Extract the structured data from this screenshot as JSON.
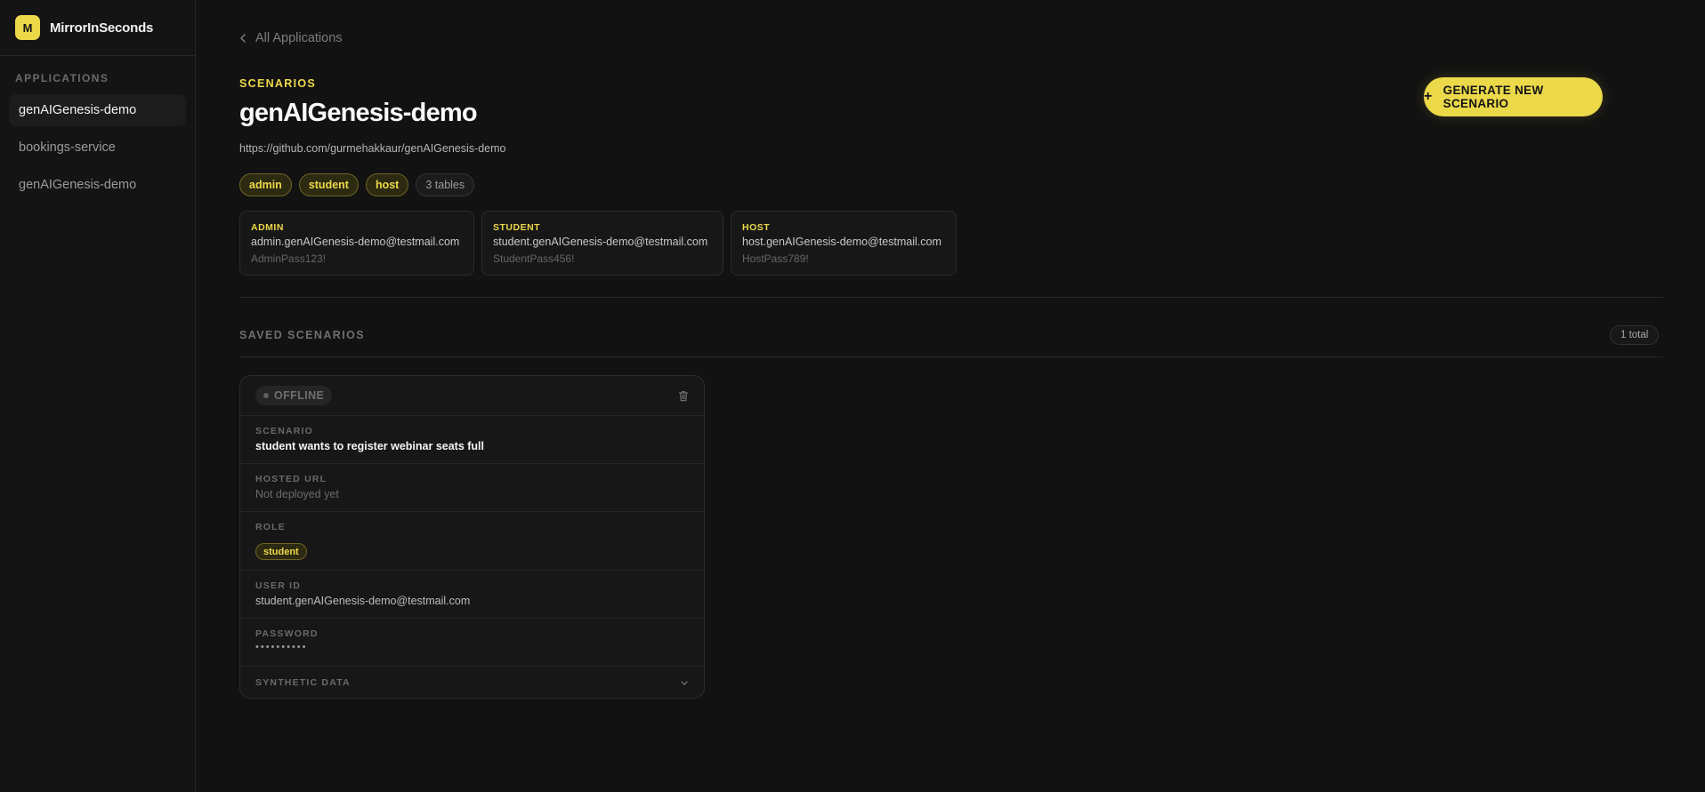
{
  "brand": {
    "logo_letter": "M",
    "name": "MirrorInSeconds"
  },
  "sidebar": {
    "section_label": "APPLICATIONS",
    "items": [
      {
        "label": "genAIGenesis-demo",
        "active": true
      },
      {
        "label": "bookings-service",
        "active": false
      },
      {
        "label": "genAIGenesis-demo",
        "active": false
      }
    ]
  },
  "header": {
    "back_label": "All Applications",
    "eyebrow": "SCENARIOS",
    "title": "genAIGenesis-demo",
    "repo_url": "https://github.com/gurmehakkaur/genAIGenesis-demo",
    "generate_button": {
      "icon": "+",
      "label": "GENERATE NEW SCENARIO"
    }
  },
  "tags": [
    "admin",
    "student",
    "host"
  ],
  "tables_count_label": "3 tables",
  "credentials": [
    {
      "role": "ADMIN",
      "email": "admin.genAIGenesis-demo@testmail.com",
      "password": "AdminPass123!"
    },
    {
      "role": "STUDENT",
      "email": "student.genAIGenesis-demo@testmail.com",
      "password": "StudentPass456!"
    },
    {
      "role": "HOST",
      "email": "host.genAIGenesis-demo@testmail.com",
      "password": "HostPass789!"
    }
  ],
  "saved": {
    "label": "SAVED SCENARIOS",
    "total_label": "1 total"
  },
  "scenario_card": {
    "status": "OFFLINE",
    "scenario_label": "SCENARIO",
    "scenario_value": "student wants to register webinar seats full",
    "hosted_url_label": "HOSTED URL",
    "hosted_url_value": "Not deployed yet",
    "role_label": "ROLE",
    "role_value": "student",
    "user_id_label": "USER ID",
    "user_id_value": "student.genAIGenesis-demo@testmail.com",
    "password_label": "PASSWORD",
    "password_value": "••••••••••",
    "synthetic_label": "SYNTHETIC DATA"
  },
  "colors": {
    "accent": "#ecd94a",
    "background": "#121212",
    "sidebar": "#141414"
  },
  "icons": {
    "back": "chevron-left-icon",
    "delete": "trash-icon",
    "expand": "chevron-down-icon"
  }
}
